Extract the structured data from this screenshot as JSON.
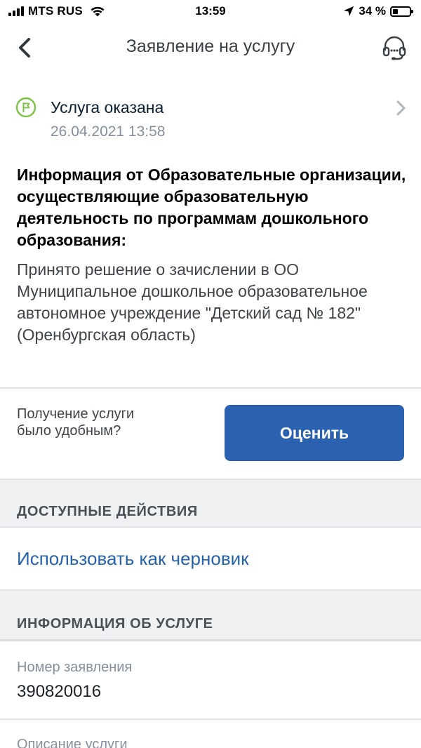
{
  "status_bar": {
    "carrier": "MTS RUS",
    "time": "13:59",
    "battery_percent": "34 %",
    "battery_level": 0.34
  },
  "nav": {
    "title": "Заявление на услугу",
    "back_icon": "chevron-left-icon",
    "support_icon": "headset-icon"
  },
  "status": {
    "title": "Услуга оказана",
    "date": "26.04.2021 13:58",
    "icon": "flag-icon",
    "accent_color": "#7cc242"
  },
  "info": {
    "heading": "Информация от Образовательные организации, осуществляющие образовательную деятельность по программам дошкольного образования:",
    "body": "Принято решение о зачислении в ОО Муниципальное дошкольное образовательное автономное учреждение \"Детский сад № 182\" (Оренбургская область)"
  },
  "rate": {
    "question": "Получение услуги было удобным?",
    "button_label": "Оценить",
    "button_color": "#2a62b0"
  },
  "sections": {
    "actions_title": "ДОСТУПНЫЕ ДЕЙСТВИЯ",
    "service_info_title": "ИНФОРМАЦИЯ ОБ УСЛУГЕ"
  },
  "actions": {
    "use_as_draft": "Использовать как черновик",
    "link_color": "#2662ad"
  },
  "service_info": {
    "number_label": "Номер заявления",
    "number_value": "390820016",
    "description_label": "Описание услуги"
  }
}
